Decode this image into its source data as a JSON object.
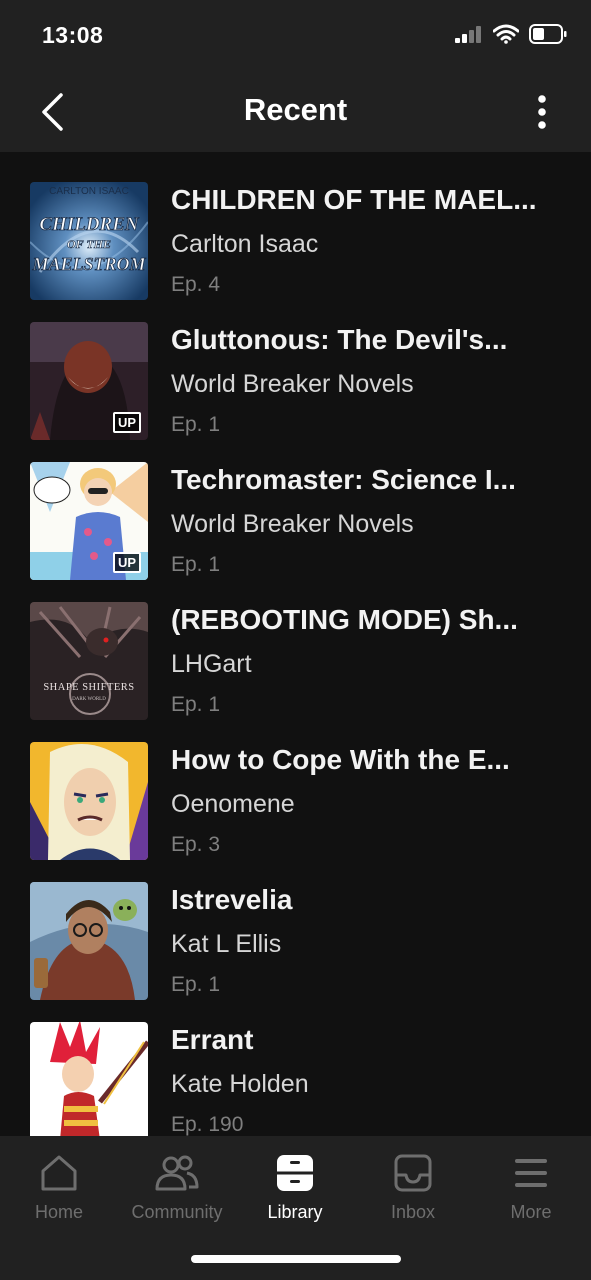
{
  "status_bar": {
    "time": "13:08"
  },
  "header": {
    "title": "Recent"
  },
  "items": [
    {
      "title": "CHILDREN OF THE MAEL...",
      "author": "Carlton Isaac",
      "episode": "Ep. 4",
      "badge": "",
      "cover_text_top": "CARLTON ISAAC",
      "cover_text_1": "CHILDREN",
      "cover_text_2": "OF THE",
      "cover_text_3": "MAELSTROM"
    },
    {
      "title": "Gluttonous: The Devil's...",
      "author": "World Breaker Novels",
      "episode": "Ep. 1",
      "badge": "UP"
    },
    {
      "title": "Techromaster: Science I...",
      "author": "World Breaker Novels",
      "episode": "Ep. 1",
      "badge": "UP"
    },
    {
      "title": "(REBOOTING MODE) Sh...",
      "author": "LHGart",
      "episode": "Ep. 1",
      "badge": "",
      "cover_text_1": "SHAPE SHIFTERS",
      "cover_text_2": "DARK WORLD"
    },
    {
      "title": "How to Cope With the E...",
      "author": "Oenomene",
      "episode": "Ep. 3",
      "badge": ""
    },
    {
      "title": "Istrevelia",
      "author": "Kat L Ellis",
      "episode": "Ep. 1",
      "badge": ""
    },
    {
      "title": "Errant",
      "author": "Kate Holden",
      "episode": "Ep. 190",
      "badge": ""
    }
  ],
  "tabs": [
    {
      "label": "Home",
      "icon": "home-icon",
      "active": false
    },
    {
      "label": "Community",
      "icon": "community-icon",
      "active": false
    },
    {
      "label": "Library",
      "icon": "library-icon",
      "active": true
    },
    {
      "label": "Inbox",
      "icon": "inbox-icon",
      "active": false
    },
    {
      "label": "More",
      "icon": "menu-icon",
      "active": false
    }
  ],
  "colors": {
    "background": "#111111",
    "bar": "#212121",
    "inactive": "#6e6e6e",
    "active": "#ffffff"
  }
}
